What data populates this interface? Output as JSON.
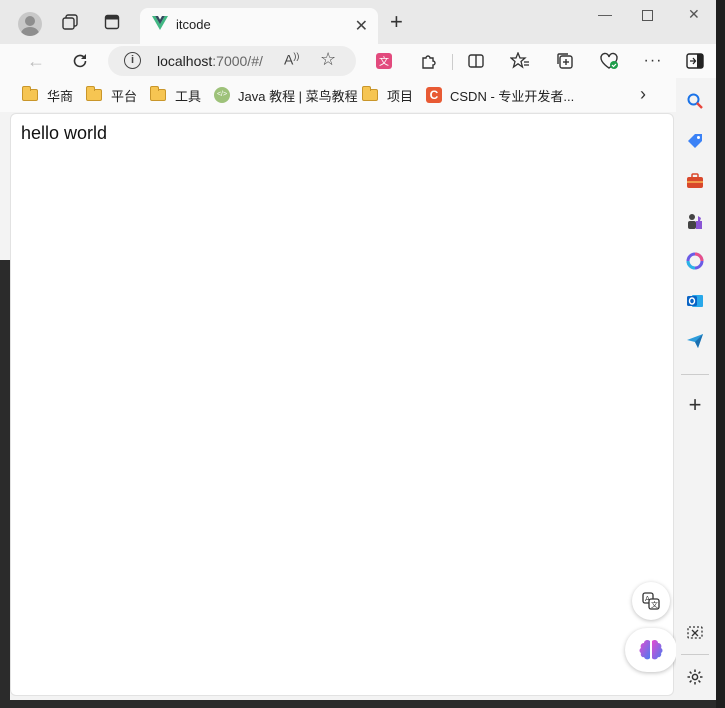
{
  "tab": {
    "title": "itcode"
  },
  "address": {
    "url_host": "localhost",
    "url_rest": ":7000/#/"
  },
  "bookmarks": [
    {
      "label": "华商",
      "icon": "folder-icon"
    },
    {
      "label": "平台",
      "icon": "folder-icon"
    },
    {
      "label": "工具",
      "icon": "folder-icon"
    },
    {
      "label": "Java 教程 | 菜鸟教程",
      "icon": "runoob-icon"
    },
    {
      "label": "项目",
      "icon": "folder-icon"
    },
    {
      "label": "CSDN - 专业开发者...",
      "icon": "csdn-icon"
    }
  ],
  "page": {
    "content": "hello world"
  },
  "colors": {
    "accent": "#0078d4",
    "vue_green": "#41b883",
    "vue_dark": "#34495e"
  }
}
